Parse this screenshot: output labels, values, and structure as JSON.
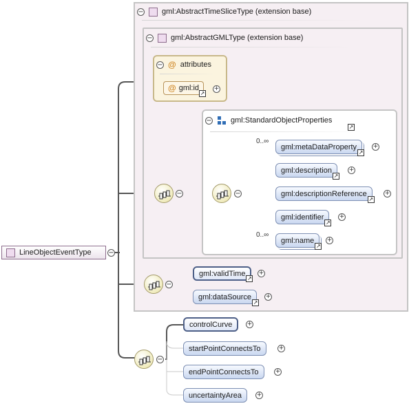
{
  "root_element": {
    "label": "LineObjectEventType"
  },
  "extension_time_slice": {
    "label": "gml:AbstractTimeSliceType (extension base)"
  },
  "extension_gml": {
    "label": "gml:AbstractGMLType (extension base)"
  },
  "attributes": {
    "title": "attributes",
    "items": [
      {
        "label": "gml:id"
      }
    ]
  },
  "standard_props": {
    "label": "gml:StandardObjectProperties",
    "items": [
      {
        "label": "gml:metaDataProperty",
        "occurrence": "0..∞"
      },
      {
        "label": "gml:description"
      },
      {
        "label": "gml:descriptionReference"
      },
      {
        "label": "gml:identifier"
      },
      {
        "label": "gml:name",
        "occurrence": "0..∞"
      }
    ]
  },
  "time_slice_elements": [
    {
      "label": "gml:validTime"
    },
    {
      "label": "gml:dataSource"
    }
  ],
  "own_elements": [
    {
      "label": "controlCurve"
    },
    {
      "label": "startPointConnectsTo"
    },
    {
      "label": "endPointConnectsTo"
    },
    {
      "label": "uncertaintyArea"
    }
  ],
  "symbols": {
    "collapse": "−",
    "expand": "+",
    "attribute_icon": "@",
    "reference_icon": "↗",
    "type_icon": "type-square-icon",
    "sequence_icon": "sequence-compositor-icon",
    "group_icon": "group-icon"
  },
  "colors": {
    "frame_fill": "#f6eff3",
    "element_fill": "#c9d7f0",
    "compositor_fill": "#f3efc7",
    "attribute_fill": "#fbf4df"
  }
}
